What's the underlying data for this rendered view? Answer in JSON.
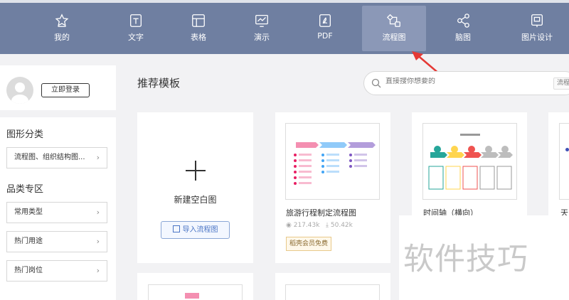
{
  "nav": {
    "items": [
      {
        "label": "我的",
        "icon": "star-icon"
      },
      {
        "label": "文字",
        "icon": "document-icon"
      },
      {
        "label": "表格",
        "icon": "table-icon"
      },
      {
        "label": "演示",
        "icon": "presentation-icon"
      },
      {
        "label": "PDF",
        "icon": "pdf-icon"
      },
      {
        "label": "流程图",
        "icon": "flowchart-icon",
        "active": true
      },
      {
        "label": "脑图",
        "icon": "mindmap-icon"
      },
      {
        "label": "图片设计",
        "icon": "image-design-icon"
      }
    ]
  },
  "user": {
    "login_label": "立即登录"
  },
  "sidebar": {
    "section_shape": "图形分类",
    "shape_items": [
      {
        "label": "流程图、组织结构图..."
      }
    ],
    "section_category": "品类专区",
    "category_items": [
      {
        "label": "常用类型"
      },
      {
        "label": "热门用途"
      },
      {
        "label": "热门岗位"
      }
    ]
  },
  "main": {
    "title": "推荐模板",
    "search_placeholder": "直接搜你想要的",
    "search_tag": "流程",
    "blank_label": "新建空白图",
    "import_label": "导入流程图",
    "templates": [
      {
        "name": "旅游行程制定流程图",
        "views": "217.43k",
        "downloads": "50.42k",
        "badge": "稻壳会员免费"
      },
      {
        "name": "时间轴（横向）"
      },
      {
        "name": "天"
      }
    ]
  },
  "watermark": "软件技巧",
  "colors": {
    "nav_bg": "#6f7fa1",
    "nav_active": "#8b98b7",
    "arrow": "#e53935",
    "accent": "#4a74c4"
  }
}
